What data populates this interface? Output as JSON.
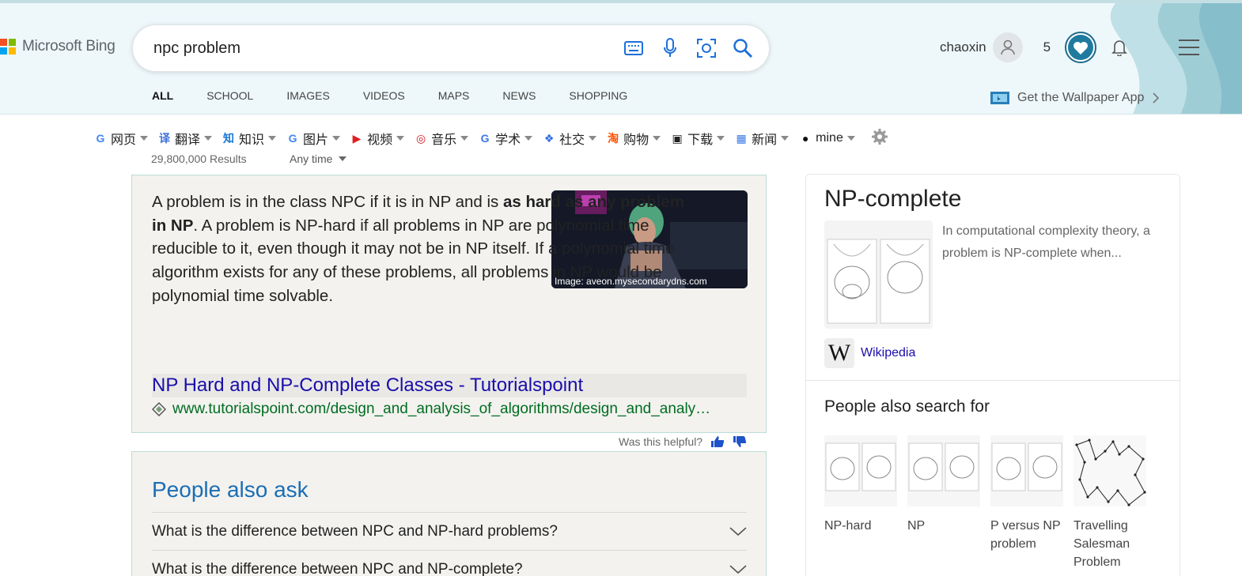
{
  "header": {
    "logo_text": "Microsoft Bing",
    "search_value": "npc problem",
    "tabs": [
      {
        "label": "ALL",
        "active": true
      },
      {
        "label": "SCHOOL"
      },
      {
        "label": "IMAGES"
      },
      {
        "label": "VIDEOS"
      },
      {
        "label": "MAPS"
      },
      {
        "label": "NEWS"
      },
      {
        "label": "SHOPPING"
      }
    ],
    "user_name": "chaoxin",
    "rewards_count": "5",
    "wallpaper_text": "Get the Wallpaper App",
    "icons": [
      "keyboard-icon",
      "microphone-icon",
      "visual-search-icon",
      "search-icon",
      "user-icon",
      "heart-icon",
      "bell-icon",
      "menu-icon",
      "chevron-right-icon"
    ]
  },
  "extensions": [
    {
      "label": "网页",
      "glyph": "G",
      "color": "#4285f4"
    },
    {
      "label": "翻译",
      "glyph": "译",
      "color": "#3b6fd8"
    },
    {
      "label": "知识",
      "glyph": "知",
      "color": "#1a78d6"
    },
    {
      "label": "图片",
      "glyph": "G",
      "color": "#4285f4"
    },
    {
      "label": "视频",
      "glyph": "▶",
      "color": "#e02020"
    },
    {
      "label": "音乐",
      "glyph": "◎",
      "color": "#d7191f"
    },
    {
      "label": "学术",
      "glyph": "G",
      "color": "#3b78e7"
    },
    {
      "label": "社交",
      "glyph": "❖",
      "color": "#2a6be6"
    },
    {
      "label": "购物",
      "glyph": "淘",
      "color": "#ff5000"
    },
    {
      "label": "下载",
      "glyph": "▣",
      "color": "#222222"
    },
    {
      "label": "新闻",
      "glyph": "▦",
      "color": "#3b78e7"
    },
    {
      "label": "mine",
      "glyph": "●",
      "color": "#111111"
    }
  ],
  "results_count": "29,800,000 Results",
  "any_time": "Any time",
  "answer": {
    "text_pre": "A problem is in the class NPC if it is in NP and is ",
    "text_bold": "as hard as any problem in NP",
    "text_post": ". A problem is NP-hard if all problems in NP are polynomial time reducible to it, even though it may not be in NP itself. If a polynomial time algorithm exists for any of these problems, all problems in NP would be polynomial time solvable.",
    "image_caption": "Image: aveon.mysecondarydns.com",
    "link_title": "NP Hard and NP-Complete Classes - Tutorialspoint",
    "link_url": "www.tutorialspoint.com/design_and_analysis_of_algorithms/design_and_analy…"
  },
  "helpful": {
    "label": "Was this helpful?"
  },
  "people_also_ask": {
    "title": "People also ask",
    "questions": [
      "What is the difference between NPC and NP-hard problems?",
      "What is the difference between NPC and NP-complete?"
    ]
  },
  "knowledge_panel": {
    "title": "NP-complete",
    "description": "In computational complexity theory, a problem is NP-complete when...",
    "source": "Wikipedia",
    "also_search_title": "People also search for",
    "also_search": [
      {
        "label": "NP-hard"
      },
      {
        "label": "NP"
      },
      {
        "label": "P versus NP problem"
      },
      {
        "label": "Travelling Salesman Problem"
      }
    ]
  },
  "colors": {
    "accent": "#174ae4",
    "link": "#1a0dab",
    "url_green": "#006d21",
    "paa_blue": "#1a6eb5"
  }
}
